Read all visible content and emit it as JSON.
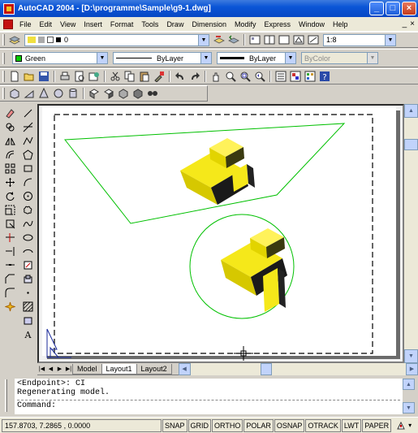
{
  "window": {
    "title": "AutoCAD 2004 - [D:\\programme\\Sample\\g9-1.dwg]",
    "minimize": "_",
    "maximize": "□",
    "close": "×"
  },
  "menu": {
    "items": [
      "File",
      "Edit",
      "View",
      "Insert",
      "Format",
      "Tools",
      "Draw",
      "Dimension",
      "Modify",
      "Express",
      "Window",
      "Help"
    ],
    "mdi": [
      "_",
      "×"
    ]
  },
  "layers": {
    "current_layer": "0",
    "scale_value": "1:8"
  },
  "properties": {
    "color": "Green",
    "linetype": "ByLayer",
    "lineweight": "ByLayer",
    "plotstyle": "ByColor"
  },
  "colors": {
    "accent_green": "#00aa00",
    "model_yellow": "#f0e000"
  },
  "layout_tabs": [
    "Model",
    "Layout1",
    "Layout2"
  ],
  "command": {
    "lines": [
      "<Endpoint>: CI",
      "Regenerating model."
    ],
    "prompt": "Command:"
  },
  "status": {
    "coordinates": "157.8703, 7.2865 , 0.0000",
    "buttons": [
      "SNAP",
      "GRID",
      "ORTHO",
      "POLAR",
      "OSNAP",
      "OTRACK",
      "LWT",
      "PAPER"
    ]
  }
}
